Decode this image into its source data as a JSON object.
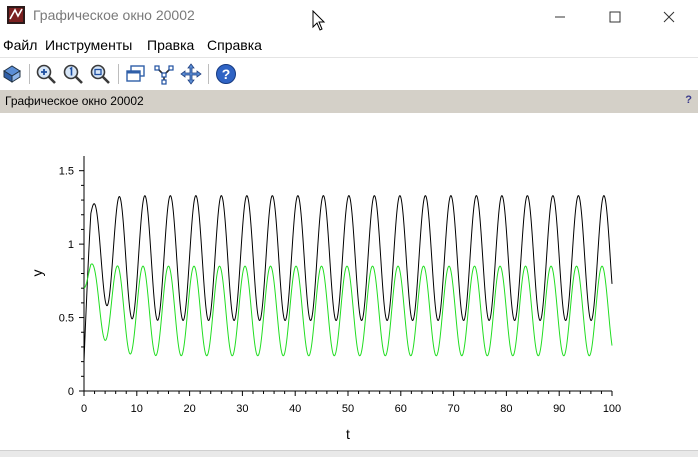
{
  "window": {
    "title": "Графическое окно 20002",
    "controls": {
      "minimize": "minimize",
      "maximize": "maximize",
      "close": "close"
    }
  },
  "menu": {
    "items": [
      {
        "label": "Файл"
      },
      {
        "label": "Инструменты"
      },
      {
        "label": "Правка"
      },
      {
        "label": "Справка"
      }
    ]
  },
  "toolbar": {
    "buttons": [
      {
        "icon": "rotate-icon"
      },
      {
        "icon": "zoom-in-icon"
      },
      {
        "icon": "zoom-original-icon"
      },
      {
        "icon": "zoom-region-icon"
      },
      {
        "icon": "window-icon"
      },
      {
        "icon": "datatip-icon"
      },
      {
        "icon": "pan-icon"
      },
      {
        "icon": "help-icon"
      }
    ]
  },
  "panel": {
    "title": "Графическое окно 20002",
    "help_mark": "?"
  },
  "chart_data": {
    "type": "line",
    "title": "",
    "xlabel": "t",
    "ylabel": "y",
    "xlim": [
      0,
      100
    ],
    "ylim": [
      0,
      1.6
    ],
    "xticks": [
      "0",
      "10",
      "20",
      "30",
      "40",
      "50",
      "60",
      "70",
      "80",
      "90",
      "100"
    ],
    "yticks": [
      "0",
      "0.5",
      "1",
      "1.5"
    ],
    "grid": false,
    "period": 4.83,
    "series": [
      {
        "color": "#000000",
        "initial": 0.2,
        "first_peak": 1.2,
        "min": 0.48,
        "max": 1.33
      },
      {
        "color": "#22dd22",
        "initial": 0.7,
        "first_peak": 0.88,
        "min": 0.24,
        "max": 0.85
      }
    ],
    "colors": {
      "series_1": "#000000",
      "series_2": "#22dd22"
    }
  }
}
